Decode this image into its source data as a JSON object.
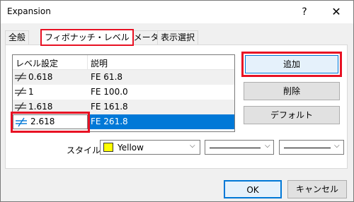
{
  "window": {
    "title": "Expansion",
    "help": "?",
    "close": "✕"
  },
  "tabs": [
    {
      "label": "全般"
    },
    {
      "label": "フィボナッチ・レベル"
    },
    {
      "label": "パラメーター"
    },
    {
      "label": "表示選択"
    }
  ],
  "levels": {
    "columns": [
      "レベル設定",
      "説明"
    ],
    "rows": [
      {
        "level": "0.618",
        "description": "FE 61.8"
      },
      {
        "level": "1",
        "description": "FE 100.0"
      },
      {
        "level": "1.618",
        "description": "FE 161.8"
      },
      {
        "level": "2.618",
        "description": "FE 261.8"
      }
    ]
  },
  "buttons": {
    "add": "追加",
    "delete": "削除",
    "default": "デフォルト",
    "ok": "OK",
    "cancel": "キャンセル"
  },
  "style": {
    "label": "スタイル",
    "color_name": "Yellow",
    "color": "#ffff00"
  },
  "icons": {
    "row": "level-style-icon",
    "dropdown": "chevron-down-icon"
  }
}
